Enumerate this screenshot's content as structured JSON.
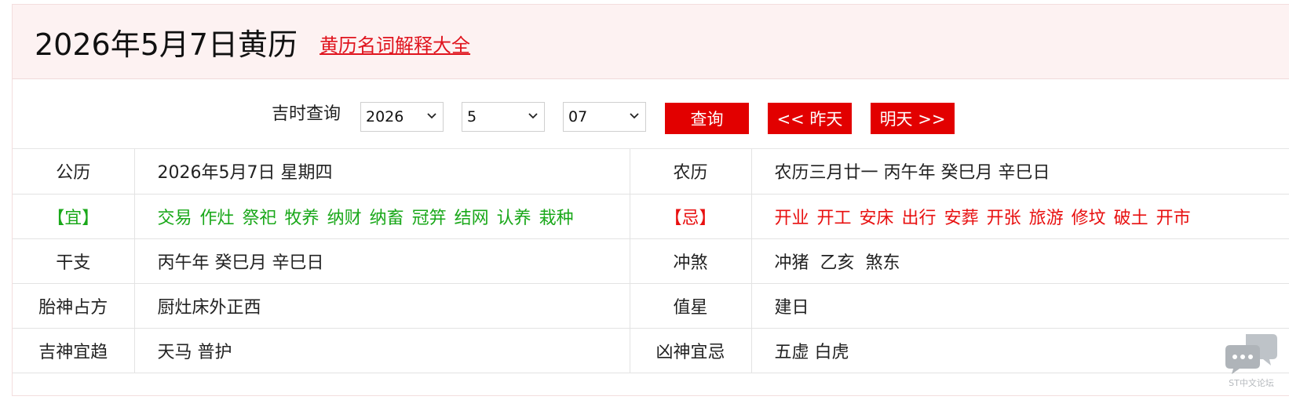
{
  "header": {
    "title": "2026年5月7日黄历",
    "glossary_link": "黄历名词解释大全"
  },
  "query": {
    "label": "吉时查询",
    "year": "2026",
    "month": "5",
    "day": "07",
    "search_button": "查询",
    "prev_button": "<< 昨天",
    "next_button": "明天 >>"
  },
  "rows": {
    "solar_label": "公历",
    "solar_value": "2026年5月7日 星期四",
    "lunar_label": "农历",
    "lunar_value": "农历三月廿一 丙午年 癸巳月 辛巳日",
    "yi_label": "【宜】",
    "yi_items": [
      "交易",
      "作灶",
      "祭祀",
      "牧养",
      "纳财",
      "纳畜",
      "冠笄",
      "结网",
      "认养",
      "栽种"
    ],
    "ji_label": "【忌】",
    "ji_items": [
      "开业",
      "开工",
      "安床",
      "出行",
      "安葬",
      "开张",
      "旅游",
      "修坟",
      "破土",
      "开市"
    ],
    "ganzhi_label": "干支",
    "ganzhi_value": "丙午年 癸巳月 辛巳日",
    "chongsha_label": "冲煞",
    "chongsha_value": "冲猪  乙亥  煞东",
    "taishen_label": "胎神占方",
    "taishen_value": "厨灶床外正西",
    "zhixing_label": "值星",
    "zhixing_value": "建日",
    "jishen_label": "吉神宜趋",
    "jishen_value": "天马 普护",
    "xiongshen_label": "凶神宜忌",
    "xiongshen_value": "五虚 白虎"
  },
  "watermark": {
    "icon": "chat-bubbles-icon",
    "text": "ST中文论坛"
  },
  "colors": {
    "accent": "#e20000",
    "yi": "#1aa81a",
    "ji": "#e81010",
    "header_bg": "#fdf2f2"
  }
}
